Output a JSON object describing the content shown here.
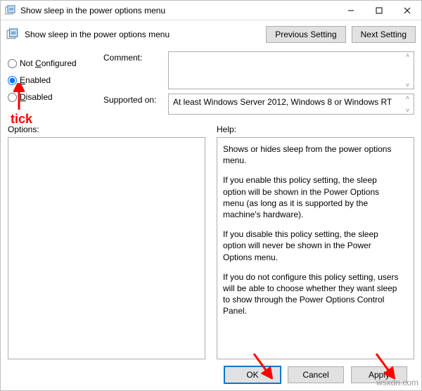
{
  "window": {
    "title": "Show sleep in the power options menu",
    "subtitle": "Show sleep in the power options menu",
    "minimize": "–",
    "maximize": "□",
    "close": "✕"
  },
  "nav": {
    "prev": "Previous Setting",
    "next": "Next Setting"
  },
  "radios": {
    "not_configured": {
      "prefix": "Not ",
      "ukey": "C",
      "suffix": "onfigured"
    },
    "enabled": {
      "ukey": "E",
      "suffix": "nabled"
    },
    "disabled": {
      "ukey": "D",
      "suffix": "isabled"
    }
  },
  "labels": {
    "comment": "Comment:",
    "supported": "Supported on:",
    "options": "Options:",
    "help": "Help:"
  },
  "supported_text": "At least Windows Server 2012, Windows 8 or Windows RT",
  "help": {
    "p1": "Shows or hides sleep from the power options menu.",
    "p2": "If you enable this policy setting, the sleep option will be shown in the Power Options menu (as long as it is supported by the machine's hardware).",
    "p3": "If you disable this policy setting, the sleep option will never be shown in the Power Options menu.",
    "p4": "If you do not configure this policy setting, users will be able to choose whether they want sleep to show through the Power Options Control Panel."
  },
  "buttons": {
    "ok": "OK",
    "cancel": "Cancel",
    "apply": "Apply"
  },
  "annotation": {
    "tick": "tick"
  },
  "watermark": "wsxdn.com"
}
